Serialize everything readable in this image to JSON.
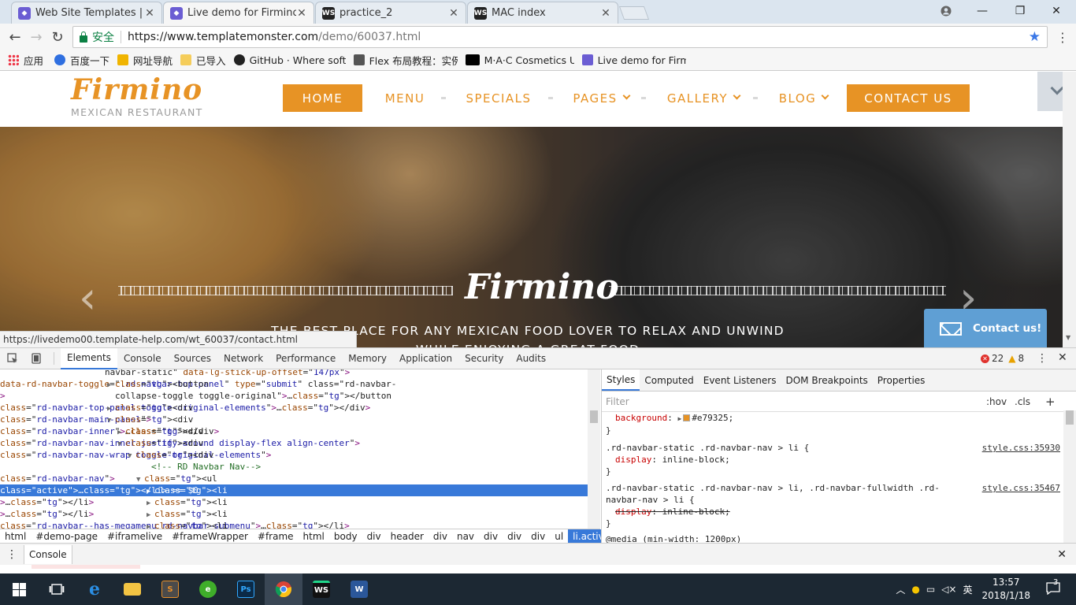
{
  "browser": {
    "tabs": [
      {
        "label": "Web Site Templates | W",
        "icon": "templatemonster-icon",
        "active": false
      },
      {
        "label": "Live demo for Firmino",
        "icon": "templatemonster-icon",
        "active": true
      },
      {
        "label": "practice_2",
        "icon": "webstorm-icon",
        "active": false
      },
      {
        "label": "MAC index",
        "icon": "webstorm-icon",
        "active": false
      }
    ],
    "secure_label": "安全",
    "url_host": "https://www.templatemonster.com",
    "url_path": "/demo/60037.html",
    "bookmarks": [
      {
        "label": "应用",
        "icon": "apps-grid-icon"
      },
      {
        "label": "百度一下",
        "icon": "baidu-icon"
      },
      {
        "label": "网址导航",
        "icon": "hao123-icon"
      },
      {
        "label": "已导入",
        "icon": "folder-icon"
      },
      {
        "label": "GitHub · Where soft",
        "icon": "github-icon"
      },
      {
        "label": "Flex 布局教程：实例",
        "icon": "ruanyifeng-icon"
      },
      {
        "label": "M·A·C Cosmetics Ur",
        "icon": "mac-cosmetics-icon"
      },
      {
        "label": "Live demo for Firmi",
        "icon": "templatemonster-icon"
      }
    ]
  },
  "site": {
    "logo": "Firmino",
    "logo_sub": "MEXICAN RESTAURANT",
    "nav": [
      {
        "label": "HOME",
        "filled": true,
        "caret": false
      },
      {
        "label": "MENU",
        "filled": false,
        "caret": false
      },
      {
        "label": "SPECIALS",
        "filled": false,
        "caret": false
      },
      {
        "label": "PAGES",
        "filled": false,
        "caret": true
      },
      {
        "label": "GALLERY",
        "filled": false,
        "caret": true
      },
      {
        "label": "BLOG",
        "filled": false,
        "caret": true
      },
      {
        "label": "CONTACT US",
        "filled": true,
        "caret": false
      }
    ],
    "hero_title": "Firmino",
    "hero_sub": "THE BEST PLACE FOR ANY MEXICAN FOOD LOVER TO RELAX AND UNWIND WHILE ENJOYING A GREAT FOOD",
    "contact_popup": "Contact us!",
    "accent": "#e79325"
  },
  "status_url": "https://livedemo00.template-help.com/wt_60037/contact.html",
  "devtools": {
    "tabs": [
      "Elements",
      "Console",
      "Sources",
      "Network",
      "Performance",
      "Memory",
      "Application",
      "Security",
      "Audits"
    ],
    "active_tab": "Elements",
    "errors": "22",
    "warnings": "8",
    "dom_lines": [
      {
        "text": "navbar-static\" data-lg-stick-up-offset=\"147px\">",
        "indent": 135,
        "tri": ""
      },
      {
        "text": "<button data-rd-navbar-toggle=\".rd-navbar-top-panel\" type=\"submit\" class=\"rd-navbar-",
        "indent": 148,
        "tri": "▶"
      },
      {
        "text": "collapse-toggle toggle-original\">…</button>",
        "indent": 148,
        "tri": ""
      },
      {
        "text": "<div class=\"rd-navbar-top-panel toggle-original-elements\">…</div>",
        "indent": 148,
        "tri": "▶"
      },
      {
        "text": "<div class=\"rd-navbar-main-panel\">",
        "indent": 148,
        "tri": "▼"
      },
      {
        "text": "<div class=\"rd-navbar-inner\">…</div>",
        "indent": 161,
        "tri": "▶"
      },
      {
        "text": "<div class=\"rd-navbar-nav-inner justify-around display-flex align-center\">",
        "indent": 161,
        "tri": "▼"
      },
      {
        "text": "<div class=\"rd-navbar-nav-wrap toggle-original-elements\">",
        "indent": 174,
        "tri": "▼"
      },
      {
        "text": "<!-- RD Navbar Nav-->",
        "indent": 194,
        "tri": ""
      },
      {
        "text": "<ul class=\"rd-navbar-nav\">",
        "indent": 185,
        "tri": "▼"
      },
      {
        "text": "<li class=\"active\">…</li> == $0",
        "indent": 198,
        "tri": "▶"
      },
      {
        "text": "<li>…</li>",
        "indent": 198,
        "tri": "▶"
      },
      {
        "text": "<li>…</li>",
        "indent": 198,
        "tri": "▶"
      },
      {
        "text": "<li class=\"rd-navbar--has-megamenu rd-navbar-submenu\">…</li>",
        "indent": 198,
        "tri": "▶"
      }
    ],
    "selected_line": 10,
    "selected_marker": "...",
    "breadcrumbs": [
      "html",
      "#demo-page",
      "#iframelive",
      "#frameWrapper",
      "#frame",
      "html",
      "body",
      "div",
      "header",
      "div",
      "nav",
      "div",
      "div",
      "div",
      "ul",
      "li.active"
    ],
    "style_tabs": [
      "Styles",
      "Computed",
      "Event Listeners",
      "DOM Breakpoints",
      "Properties"
    ],
    "filter_placeholder": "Filter",
    "hov": ":hov",
    "cls": ".cls",
    "plus": "+",
    "rules": [
      {
        "selector": "",
        "prop": "background",
        "value": "#e79325",
        "source": "",
        "strike": false,
        "swatch": "#e79325"
      },
      {
        "selector": ".rd-navbar-static .rd-navbar-nav > li {",
        "prop": "display",
        "value": "inline-block",
        "source": "style.css:35930",
        "strike": false
      },
      {
        "selector": ".rd-navbar-static .rd-navbar-nav > li, .rd-navbar-fullwidth .rd-navbar-nav > li {",
        "prop": "display",
        "value": "inline-block",
        "source": "style.css:35467",
        "strike": true
      },
      {
        "selector": "@media (min-width: 1200px)",
        "prop": "",
        "value": "",
        "source": "",
        "strike": false
      }
    ],
    "drawer_label": "Console"
  },
  "taskbar": {
    "apps": [
      "windows-start-icon",
      "task-view-icon",
      "edge-icon",
      "file-explorer-icon",
      "sublime-icon",
      "360-browser-icon",
      "photoshop-icon",
      "chrome-icon",
      "webstorm-icon",
      "word-icon"
    ],
    "time": "13:57",
    "date": "2018/1/18",
    "ime": "英",
    "notifications": "3"
  }
}
